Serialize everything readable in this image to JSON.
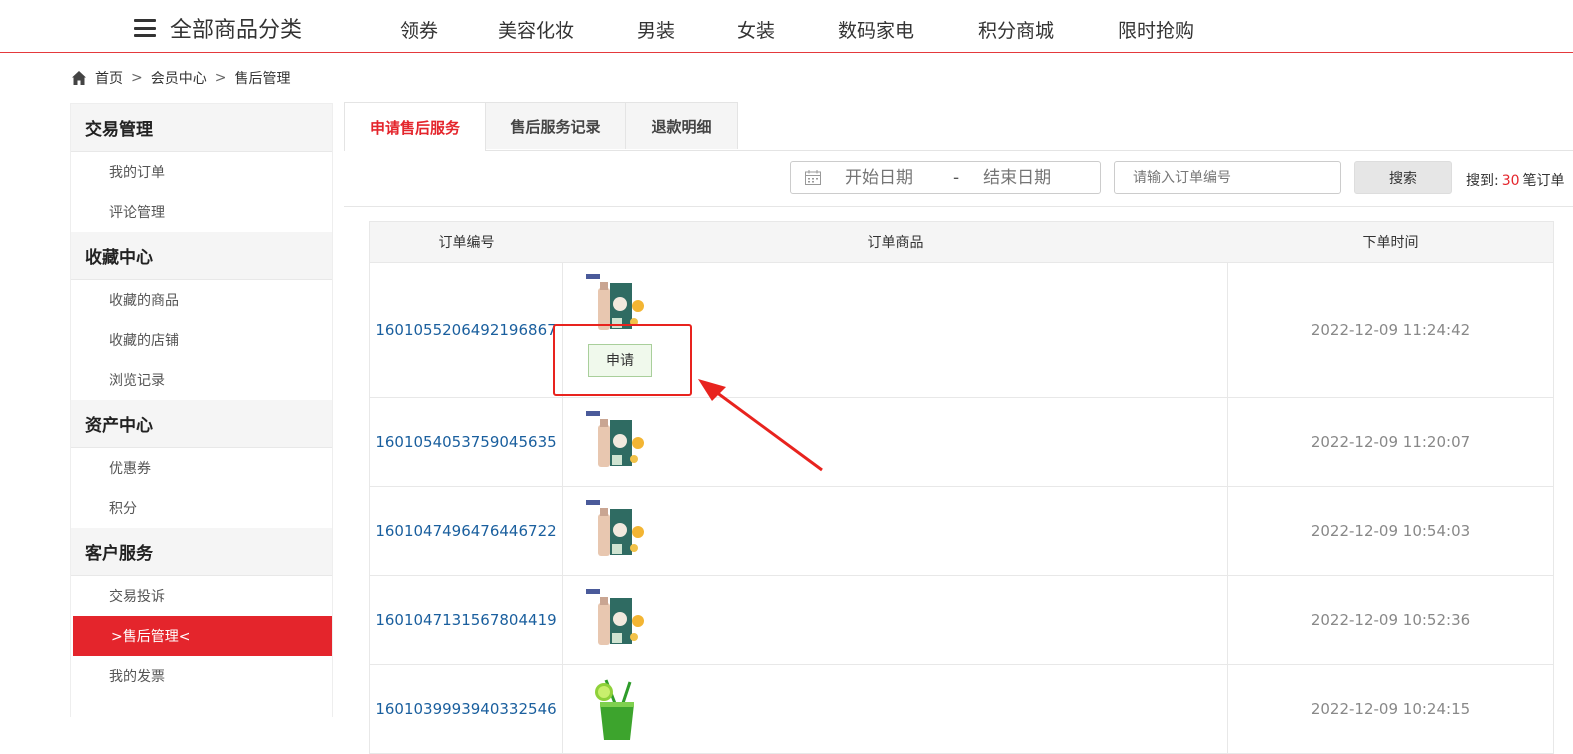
{
  "nav": {
    "all_categories": "全部商品分类",
    "links": [
      "领券",
      "美容化妆",
      "男装",
      "女装",
      "数码家电",
      "积分商城",
      "限时抢购"
    ]
  },
  "breadcrumb": [
    "首页",
    "会员中心",
    "售后管理"
  ],
  "sidebar": {
    "groups": [
      {
        "title": "交易管理",
        "items": [
          "我的订单",
          "评论管理"
        ]
      },
      {
        "title": "收藏中心",
        "items": [
          "收藏的商品",
          "收藏的店铺",
          "浏览记录"
        ]
      },
      {
        "title": "资产中心",
        "items": [
          "优惠券",
          "积分"
        ]
      },
      {
        "title": "客户服务",
        "items": [
          "交易投诉",
          ">售后管理<",
          "我的发票"
        ]
      }
    ],
    "active_item": ">售后管理<"
  },
  "tabs": [
    "申请售后服务",
    "售后服务记录",
    "退款明细"
  ],
  "search": {
    "start_placeholder": "开始日期",
    "dash": "-",
    "end_placeholder": "结束日期",
    "order_placeholder": "请输入订单编号",
    "button": "搜索",
    "result_prefix": "搜到:",
    "result_count": "30",
    "result_suffix": "笔订单"
  },
  "table": {
    "headers": [
      "订单编号",
      "订单商品",
      "下单时间"
    ],
    "rows": [
      {
        "order_no": "1601055206492196867",
        "time": "2022-12-09 11:24:42",
        "product": "cosmetic",
        "apply": "申请"
      },
      {
        "order_no": "1601054053759045635",
        "time": "2022-12-09 11:20:07",
        "product": "cosmetic"
      },
      {
        "order_no": "1601047496476446722",
        "time": "2022-12-09 10:54:03",
        "product": "cosmetic"
      },
      {
        "order_no": "1601047131567804419",
        "time": "2022-12-09 10:52:36",
        "product": "cosmetic"
      },
      {
        "order_no": "1601039993940332546",
        "time": "2022-12-09 10:24:15",
        "product": "drink"
      }
    ]
  },
  "colors": {
    "accent": "#e4252c",
    "link": "#1a5f9e",
    "highlight": "#e8231e"
  }
}
